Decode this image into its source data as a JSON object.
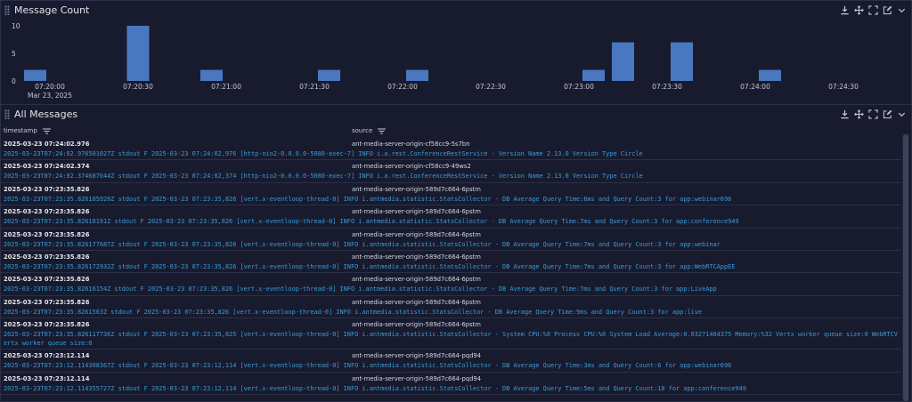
{
  "chart_panel": {
    "title": "Message Count",
    "icons": [
      "download-icon",
      "move-icon",
      "fullscreen-icon",
      "edit-icon",
      "chevron-down-icon"
    ]
  },
  "chart_data": {
    "type": "bar",
    "ylim": [
      0,
      10
    ],
    "yticks": [
      "10",
      "5",
      "0"
    ],
    "xticks": [
      "07:20:00",
      "07:20:30",
      "07:21:00",
      "07:21:30",
      "07:22:00",
      "07:22:30",
      "07:23:00",
      "07:23:30",
      "07:24:00",
      "07:24:30"
    ],
    "x_date_label": "Mar 23, 2025",
    "bars": [
      {
        "x": "07:19:55",
        "value": 2
      },
      {
        "x": "07:20:30",
        "value": 10
      },
      {
        "x": "07:20:55",
        "value": 2
      },
      {
        "x": "07:21:35",
        "value": 2
      },
      {
        "x": "07:22:05",
        "value": 2
      },
      {
        "x": "07:23:05",
        "value": 2
      },
      {
        "x": "07:23:15",
        "value": 7
      },
      {
        "x": "07:23:35",
        "value": 7
      },
      {
        "x": "07:24:05",
        "value": 2
      }
    ],
    "bar_color": "#4a78c0"
  },
  "logs_panel": {
    "title": "All Messages",
    "columns": [
      "timestamp",
      "source"
    ],
    "rows": [
      {
        "ts": "2025-03-23 07:24:02.976",
        "src": "ant-media-server-origin-cf58cc9-5s7bn",
        "msg": "2025-03-23T07:24:02.976501027Z stdout F 2025-03-23 07:24:02,976 [http-nio2-0.0.0.0-5080-exec-7] INFO i.a.rest.ConferenceRestService - Version Name 2.13.0 Version Type Circle"
      },
      {
        "ts": "2025-03-23 07:24:02.374",
        "src": "ant-media-server-origin-cf58cc9-49ws2",
        "msg": "2025-03-23T07:24:02.374687644Z stdout F 2025-03-23 07:24:02,374 [http-nio2-0.0.0.0-5080-exec-7] INFO i.a.rest.ConferenceRestService - Version Name 2.13.0 Version Type Circle"
      },
      {
        "ts": "2025-03-23 07:23:35.826",
        "src": "ant-media-server-origin-589d7c664-6pstm",
        "msg": "2025-03-23T07:23:35.826185920Z stdout F 2025-03-23 07:23:35,826 [vert.x-eventloop-thread-0] INFO i.antmedia.statistic.StatsCollector - DB Average Query Time:6ms and Query Count:3 for app:webinar696"
      },
      {
        "ts": "2025-03-23 07:23:35.826",
        "src": "ant-media-server-origin-589d7c664-6pstm",
        "msg": "2025-03-23T07:23:35.82618191Z stdout F 2025-03-23 07:23:35,826 [vert.x-eventloop-thread-0] INFO i.antmedia.statistic.StatsCollector - DB Average Query Time:7ms and Query Count:3 for app:conference949"
      },
      {
        "ts": "2025-03-23 07:23:35.826",
        "src": "ant-media-server-origin-589d7c664-6pstm",
        "msg": "2025-03-23T07:23:35.826177687Z stdout F 2025-03-23 07:23:35,826 [vert.x-eventloop-thread-0] INFO i.antmedia.statistic.StatsCollector - DB Average Query Time:7ms and Query Count:3 for app:webinar"
      },
      {
        "ts": "2025-03-23 07:23:35.826",
        "src": "ant-media-server-origin-589d7c664-6pstm",
        "msg": "2025-03-23T07:23:35.826172932Z stdout F 2025-03-23 07:23:35,826 [vert.x-eventloop-thread-0] INFO i.antmedia.statistic.StatsCollector - DB Average Query Time:7ms and Query Count:3 for app:WebRTCAppEE"
      },
      {
        "ts": "2025-03-23 07:23:35.826",
        "src": "ant-media-server-origin-589d7c664-6pstm",
        "msg": "2025-03-23T07:23:35.82616154Z stdout F 2025-03-23 07:23:35,826 [vert.x-eventloop-thread-0] INFO i.antmedia.statistic.StatsCollector - DB Average Query Time:7ms and Query Count:3 for app:LiveApp"
      },
      {
        "ts": "2025-03-23 07:23:35.826",
        "src": "ant-media-server-origin-589d7c664-6pstm",
        "msg": "2025-03-23T07:23:35.8261563Z stdout F 2025-03-23 07:23:35,826 [vert.x-eventloop-thread-0] INFO i.antmedia.statistic.StatsCollector - DB Average Query Time:9ms and Query Count:3 for app:live"
      },
      {
        "ts": "2025-03-23 07:23:35.826",
        "src": "ant-media-server-origin-589d7c664-6pstm",
        "msg": "2025-03-23T07:23:35.826117736Z stdout F 2025-03-23 07:23:35,825 [vert.x-eventloop-thread-0] INFO i.antmedia.statistic.StatsCollector - System CPU:%0 Process CPU:%0 System Load Average:0.03271484375 Memory:%32 Vertx worker queue size:0 WebRTCVertx worker queue size:0",
        "tall": true
      },
      {
        "ts": "2025-03-23 07:23:12.114",
        "src": "ant-media-server-origin-589d7c664-pqd94",
        "msg": "2025-03-23T07:23:12.114308367Z stdout F 2025-03-23 07:23:12,114 [vert.x-eventloop-thread-0] INFO i.antmedia.statistic.StatsCollector - DB Average Query Time:3ms and Query Count:6 for app:webinar696"
      },
      {
        "ts": "2025-03-23 07:23:12.114",
        "src": "ant-media-server-origin-589d7c664-pqd94",
        "msg": "2025-03-23T07:23:12.114355727Z stdout F 2025-03-23 07:23:12,114 [vert.x-eventloop-thread-0] INFO i.antmedia.statistic.StatsCollector - DB Average Query Time:5ms and Query Count:18 for app:conference949"
      }
    ]
  }
}
